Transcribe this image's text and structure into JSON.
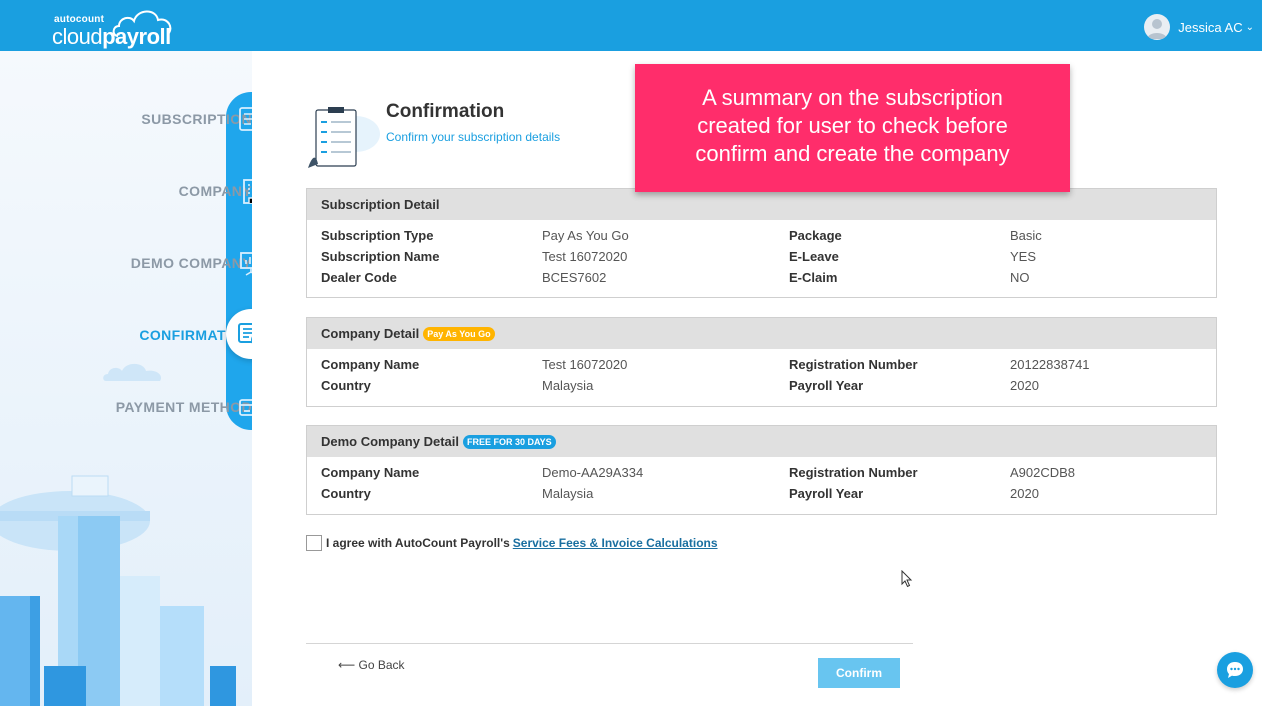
{
  "brand": {
    "small": "autocount",
    "big_light": "cloud",
    "big_bold": "payroll"
  },
  "user": {
    "name": "Jessica AC"
  },
  "steps": [
    {
      "label": "SUBSCRIPTION",
      "icon": "subscription-icon"
    },
    {
      "label": "COMPANY",
      "icon": "building-icon"
    },
    {
      "label": "DEMO COMPANY",
      "icon": "presentation-icon"
    },
    {
      "label": "CONFIRMATION",
      "icon": "confirmation-icon",
      "active": true
    },
    {
      "label": "PAYMENT METHOD",
      "icon": "credit-card-icon"
    }
  ],
  "page": {
    "title": "Confirmation",
    "subtitle": "Confirm your subscription details"
  },
  "callout": {
    "line1": "A summary on the subscription",
    "line2": "created for user to check before",
    "line3": "confirm and create the company"
  },
  "subscription_detail": {
    "title": "Subscription Detail",
    "rows": [
      {
        "l1": "Subscription Type",
        "v1": "Pay As You Go",
        "l2": "Package",
        "v2": "Basic"
      },
      {
        "l1": "Subscription Name",
        "v1": "Test 16072020",
        "l2": "E-Leave",
        "v2": "YES"
      },
      {
        "l1": "Dealer Code",
        "v1": "BCES7602",
        "l2": "E-Claim",
        "v2": "NO"
      }
    ]
  },
  "company_detail": {
    "title": "Company Detail",
    "badge": "Pay As You Go",
    "rows": [
      {
        "l1": "Company Name",
        "v1": "Test 16072020",
        "l2": "Registration Number",
        "v2": "20122838741"
      },
      {
        "l1": "Country",
        "v1": "Malaysia",
        "l2": "Payroll Year",
        "v2": "2020"
      }
    ]
  },
  "demo_company_detail": {
    "title": "Demo Company Detail",
    "badge": "FREE FOR 30 DAYS",
    "rows": [
      {
        "l1": "Company Name",
        "v1": "Demo-AA29A334",
        "l2": "Registration Number",
        "v2": "A902CDB8"
      },
      {
        "l1": "Country",
        "v1": "Malaysia",
        "l2": "Payroll Year",
        "v2": "2020"
      }
    ]
  },
  "agreement": {
    "text": "I agree with AutoCount Payroll's",
    "link": "Service Fees & Invoice Calculations",
    "checked": false
  },
  "actions": {
    "go_back": "⟵ Go Back",
    "confirm": "Confirm"
  },
  "colors": {
    "primary": "#1a9fe0",
    "callout": "#ff2d6b",
    "badge_orange": "#ffb400",
    "button": "#68c5f0"
  }
}
